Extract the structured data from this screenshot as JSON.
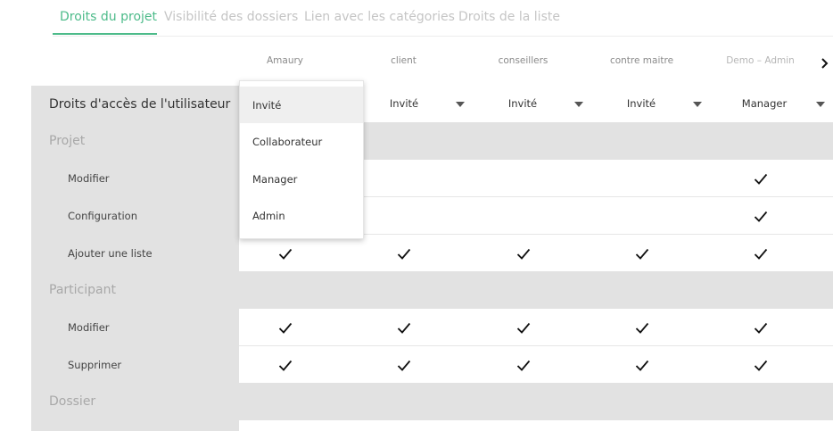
{
  "tabs": [
    {
      "label": "Droits du projet",
      "active": true
    },
    {
      "label": "Visibilité des dossiers",
      "active": false
    },
    {
      "label": "Lien avec les catégories",
      "active": false
    },
    {
      "label": "Droits de la liste",
      "active": false
    }
  ],
  "columns": [
    {
      "name": "Amaury",
      "role": "Invité"
    },
    {
      "name": "client",
      "role": "Invité"
    },
    {
      "name": "conseillers",
      "role": "Invité"
    },
    {
      "name": "contre maitre",
      "role": "Invité"
    },
    {
      "name": "Demo – Admin",
      "role": "Manager"
    }
  ],
  "header_label": "Droits d'accès de l'utilisateur",
  "sections": {
    "projet": {
      "title": "Projet",
      "items": [
        {
          "label": "Modifier",
          "checks": [
            false,
            false,
            false,
            false,
            true
          ]
        },
        {
          "label": "Configuration",
          "checks": [
            false,
            false,
            false,
            false,
            true
          ]
        },
        {
          "label": "Ajouter une liste",
          "checks": [
            true,
            true,
            true,
            true,
            true
          ]
        }
      ]
    },
    "participant": {
      "title": "Participant",
      "items": [
        {
          "label": "Modifier",
          "checks": [
            true,
            true,
            true,
            true,
            true
          ]
        },
        {
          "label": "Supprimer",
          "checks": [
            true,
            true,
            true,
            true,
            true
          ]
        }
      ]
    },
    "dossier": {
      "title": "Dossier"
    }
  },
  "dropdown": {
    "options": [
      "Invité",
      "Collaborateur",
      "Manager",
      "Admin"
    ],
    "selected_index": 0
  },
  "icons": {
    "check": "check-icon",
    "caret": "caret-down-icon",
    "next": "chevron-right-icon"
  },
  "colors": {
    "accent": "#4dbb8a",
    "row_bg": "#e2e2e2"
  }
}
